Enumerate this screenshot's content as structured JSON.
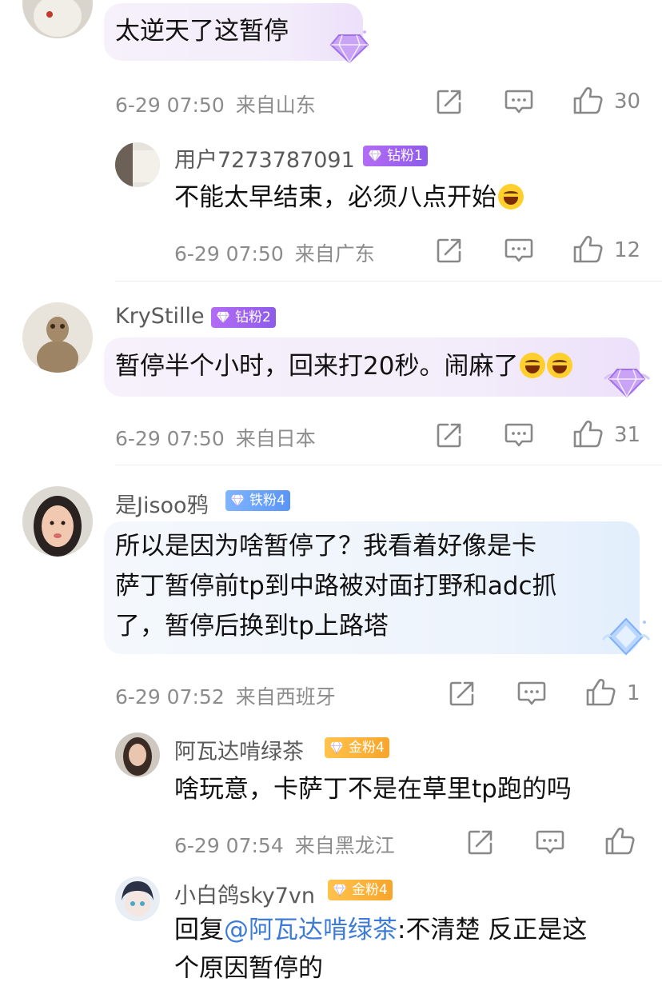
{
  "comments": [
    {
      "text": "太逆天了这暂停",
      "meta": {
        "date": "6-29 07:50",
        "location": "来自山东"
      },
      "likes": "30",
      "replies": [
        {
          "user": "用户7273787091",
          "badge": "钻粉1",
          "text": "不能太早结束，必须八点开始",
          "meta": {
            "date": "6-29 07:50",
            "location": "来自广东"
          },
          "likes": "12"
        }
      ]
    },
    {
      "user": "KryStille",
      "badge": "钻粉2",
      "text": "暂停半个小时，回来打20秒。闹麻了",
      "meta": {
        "date": "6-29 07:50",
        "location": "来自日本"
      },
      "likes": "31"
    },
    {
      "user": "是Jisoo鸦",
      "badge": "铁粉4",
      "text_lines": [
        "所以是因为啥暂停了？我看着好像是卡",
        "萨丁暂停前tp到中路被对面打野和adc抓",
        "了，暂停后换到tp上路塔"
      ],
      "meta": {
        "date": "6-29 07:52",
        "location": "来自西班牙"
      },
      "likes": "1",
      "replies": [
        {
          "user": "阿瓦达啃绿茶",
          "badge": "金粉4",
          "text": "啥玩意，卡萨丁不是在草里tp跑的吗",
          "meta": {
            "date": "6-29 07:54",
            "location": "来自黑龙江"
          }
        },
        {
          "user": "小白鸽sky7vn",
          "badge": "金粉4",
          "reply_prefix": "回复",
          "mention": "@阿瓦达啃绿茶",
          "text_line1_rest": ":不清楚 反正是这",
          "text_line2": "个原因暂停的"
        }
      ]
    }
  ],
  "icons": {
    "share": "share-icon",
    "comment": "comment-icon",
    "like": "thumbs-up-icon"
  },
  "colors": {
    "badge_purple": "#9b62ef",
    "badge_blue": "#6aa3f8",
    "badge_gold": "#f9b23a",
    "mention": "#3d7bd8"
  }
}
